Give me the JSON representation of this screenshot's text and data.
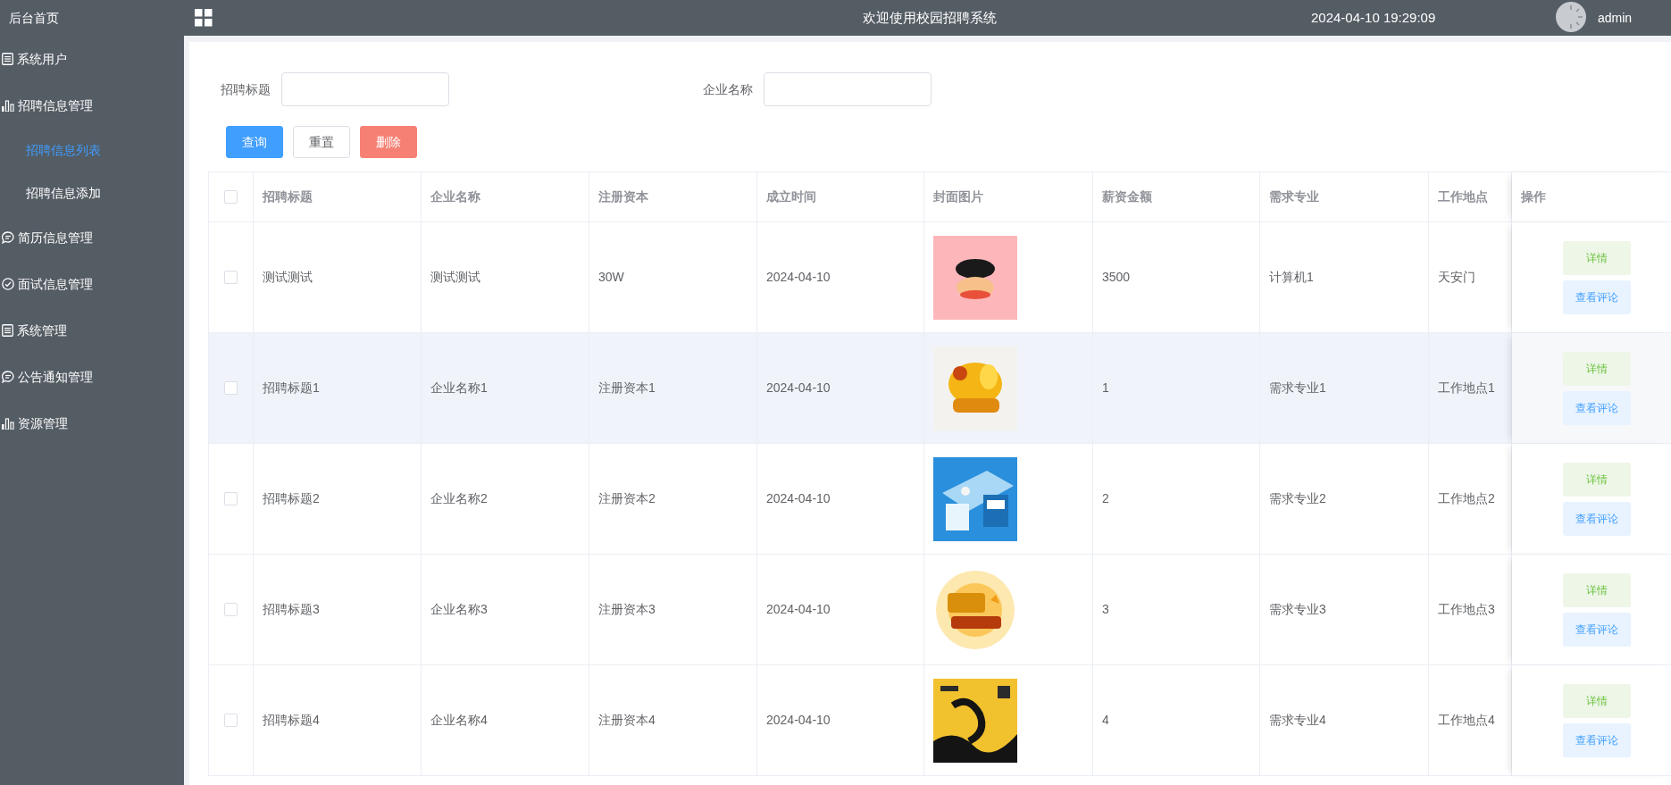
{
  "sidebar": {
    "items": [
      {
        "label": "后台首页",
        "selected": false
      },
      {
        "label": "系统用户",
        "selected": false
      },
      {
        "label": "招聘信息管理",
        "selected": false,
        "children": [
          {
            "label": "招聘信息列表",
            "selected": true
          },
          {
            "label": "招聘信息添加",
            "selected": false
          }
        ]
      },
      {
        "label": "简历信息管理",
        "selected": false
      },
      {
        "label": "面试信息管理",
        "selected": false
      },
      {
        "label": "系统管理",
        "selected": false
      },
      {
        "label": "公告通知管理",
        "selected": false
      },
      {
        "label": "资源管理",
        "selected": false
      }
    ]
  },
  "header": {
    "title": "欢迎使用校园招聘系统",
    "datetime": "2024-04-10 19:29:09",
    "user": "admin"
  },
  "filters": [
    {
      "label": "招聘标题"
    },
    {
      "label": "企业名称"
    }
  ],
  "buttons": [
    {
      "label": "查询",
      "kind": "primary"
    },
    {
      "label": "重置",
      "kind": "default"
    },
    {
      "label": "删除",
      "kind": "danger"
    }
  ],
  "table": {
    "select_all": {
      "checked": false
    },
    "columns": [
      "招聘标题",
      "企业名称",
      "注册资本",
      "成立时间",
      "封面图片",
      "薪资金额",
      "需求专业",
      "工作地点",
      "操作"
    ],
    "rows": [
      {
        "checked": false,
        "hovered": false,
        "cells": [
          "测试测试",
          "测试测试",
          "30W",
          "2024-04-10"
        ],
        "cover": {
          "kind": "picture"
        },
        "cells_after": [
          "3500",
          "计算机1",
          "天安门"
        ],
        "actions": [
          "详情",
          "查看评论"
        ]
      },
      {
        "checked": false,
        "hovered": true,
        "cells": [
          "招聘标题1",
          "企业名称1",
          "注册资本1",
          "2024-04-10"
        ],
        "cover": {
          "kind": "picture"
        },
        "cells_after": [
          "1",
          "需求专业1",
          "工作地点1"
        ],
        "actions": [
          "详情",
          "查看评论"
        ]
      },
      {
        "checked": false,
        "hovered": false,
        "cells": [
          "招聘标题2",
          "企业名称2",
          "注册资本2",
          "2024-04-10"
        ],
        "cover": {
          "kind": "picture"
        },
        "cells_after": [
          "2",
          "需求专业2",
          "工作地点2"
        ],
        "actions": [
          "详情",
          "查看评论"
        ]
      },
      {
        "checked": false,
        "hovered": false,
        "cells": [
          "招聘标题3",
          "企业名称3",
          "注册资本3",
          "2024-04-10"
        ],
        "cover": {
          "kind": "picture"
        },
        "cells_after": [
          "3",
          "需求专业3",
          "工作地点3"
        ],
        "actions": [
          "详情",
          "查看评论"
        ]
      },
      {
        "checked": false,
        "hovered": false,
        "cells": [
          "招聘标题4",
          "企业名称4",
          "注册资本4",
          "2024-04-10"
        ],
        "cover": {
          "kind": "picture"
        },
        "cells_after": [
          "4",
          "需求专业4",
          "工作地点4"
        ],
        "actions": [
          "详情",
          "查看评论"
        ]
      }
    ]
  }
}
